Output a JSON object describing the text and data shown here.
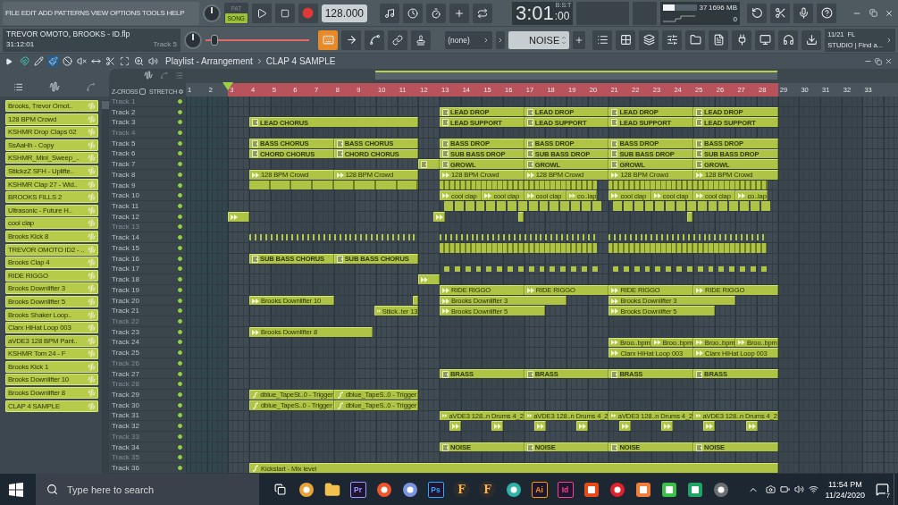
{
  "menu": [
    "FILE",
    "EDIT",
    "ADD",
    "PATTERNS",
    "VIEW",
    "OPTIONS",
    "TOOLS",
    "HELP"
  ],
  "mode": [
    {
      "label": "PAT",
      "selected": false
    },
    {
      "label": "SONG",
      "selected": true
    }
  ],
  "tempo": "128.000",
  "time": {
    "main": "3:01",
    "sub": ":00",
    "format": "B:S:T"
  },
  "cpu": {
    "level": 0.35,
    "value": "37",
    "memory": "1696 MB",
    "polyphony": "0"
  },
  "hint": {
    "title": "TREVOR OMOTO, BROOKS - ID.flp",
    "time": "31:12:01",
    "track": "Track 5"
  },
  "pitch": {
    "level": 0.05
  },
  "typing_keyboard": {
    "on": true
  },
  "pattern_select": "(none)",
  "pattern_name": "NOISE",
  "news": {
    "date": "11/21",
    "title": "FL",
    "text": "STUDIO | Find a..."
  },
  "playlist": {
    "title": "Playlist - Arrangement",
    "selected": "CLAP 4 SAMPLE",
    "tools": [
      {
        "kind": "pencil",
        "selected": false
      },
      {
        "kind": "brush",
        "selected": true
      },
      {
        "kind": "delete",
        "selected": false
      },
      {
        "kind": "mute",
        "selected": false
      },
      {
        "kind": "slip",
        "selected": false
      },
      {
        "kind": "slice",
        "selected": false
      },
      {
        "kind": "select",
        "selected": false
      },
      {
        "kind": "zoom",
        "selected": false
      },
      {
        "kind": "playback",
        "selected": false
      }
    ],
    "zcross": {
      "label": "Z-CROSS",
      "checked": false
    },
    "stretch": {
      "label": "STRETCH",
      "on": false
    }
  },
  "picker": [
    {
      "label": "Brooks, Trevor Omot.."
    },
    {
      "label": "128 BPM Crowd"
    },
    {
      "label": "KSHMR Drop Claps 02"
    },
    {
      "label": "SsAaHh - Copy"
    },
    {
      "label": "KSHMR_Mini_Sweep_.."
    },
    {
      "label": "StiickzZ SFH - Uplifte.."
    },
    {
      "label": "KSHMR Clap 27 - Wid.."
    },
    {
      "label": "BROOKS FILLS 2"
    },
    {
      "label": "Ultrasonic - Future H.."
    },
    {
      "label": "cool clap"
    },
    {
      "label": "Brooks Kick 8"
    },
    {
      "label": "TREVOR OMOTO ID2 - .."
    },
    {
      "label": "Brooks Clap 4"
    },
    {
      "label": "RIDE RIGGO"
    },
    {
      "label": "Brooks Downlifter 3"
    },
    {
      "label": "Brooks Downlifter 5"
    },
    {
      "label": "Brooks Shaker Loop.."
    },
    {
      "label": "Clarx HiHat Loop 003"
    },
    {
      "label": "aVDE3 128 BPM Pant.."
    },
    {
      "label": "KSHMR Tom 24 - F"
    },
    {
      "label": "Brooks Kick 1"
    },
    {
      "label": "Brooks Downlifter 10"
    },
    {
      "label": "Brooks Downlifter 8"
    },
    {
      "label": "CLAP 4 SAMPLE"
    }
  ],
  "ruler": {
    "bars": [
      "1",
      "2",
      "3",
      "4",
      "5",
      "6",
      "7",
      "8",
      "9",
      "10",
      "11",
      "12",
      "13",
      "14",
      "15",
      "16",
      "17",
      "18",
      "19",
      "20",
      "21",
      "22",
      "23",
      "24",
      "25",
      "26",
      "27",
      "28",
      "29",
      "30",
      "31",
      "32",
      "33"
    ]
  },
  "tracks": [
    {
      "name": "Track 1",
      "dimmed": true,
      "on": true
    },
    {
      "name": "Track 2",
      "dimmed": false,
      "on": true,
      "clips": [
        {
          "kind": "pattern",
          "label": "LEAD DROP"
        },
        {
          "kind": "pattern",
          "label": "LEAD DROP"
        },
        {
          "kind": "pattern",
          "label": "LEAD DROP"
        },
        {
          "kind": "pattern",
          "label": "LEAD DROP"
        }
      ]
    },
    {
      "name": "Track 3",
      "dimmed": false,
      "on": true,
      "clips": [
        {
          "kind": "pattern",
          "label": "LEAD CHORUS"
        },
        {
          "kind": "pattern",
          "label": "LEAD SUPPORT"
        },
        {
          "kind": "pattern",
          "label": "LEAD SUPPORT"
        },
        {
          "kind": "pattern",
          "label": "LEAD SUPPORT"
        },
        {
          "kind": "pattern",
          "label": "LEAD SUPPORT"
        }
      ]
    },
    {
      "name": "Track 4",
      "dimmed": true,
      "on": true
    },
    {
      "name": "Track 5",
      "dimmed": false,
      "on": true,
      "clips": [
        {
          "kind": "pattern",
          "label": "BASS CHORUS"
        },
        {
          "kind": "pattern",
          "label": "BASS CHORUS"
        },
        {
          "kind": "pattern",
          "label": "BASS DROP"
        },
        {
          "kind": "pattern",
          "label": "BASS DROP"
        },
        {
          "kind": "pattern",
          "label": "BASS DROP"
        },
        {
          "kind": "pattern",
          "label": "BASS DROP"
        }
      ]
    },
    {
      "name": "Track 6",
      "dimmed": false,
      "on": true,
      "clips": [
        {
          "kind": "pattern",
          "label": "CHORD CHORUS"
        },
        {
          "kind": "pattern",
          "label": "CHORD CHORUS"
        },
        {
          "kind": "pattern",
          "label": "SUB BASS DROP"
        },
        {
          "kind": "pattern",
          "label": "SUB BASS DROP"
        },
        {
          "kind": "pattern",
          "label": "SUB BASS DROP"
        },
        {
          "kind": "pattern",
          "label": "SUB BASS DROP"
        }
      ]
    },
    {
      "name": "Track 7",
      "dimmed": false,
      "on": true,
      "clips": [
        {
          "kind": "pattern"
        },
        {
          "kind": "pattern",
          "label": "GROWL"
        },
        {
          "kind": "pattern",
          "label": "GROWL"
        },
        {
          "kind": "pattern",
          "label": "GROWL"
        },
        {
          "kind": "pattern",
          "label": "GROWL"
        }
      ]
    },
    {
      "name": "Track 8",
      "dimmed": false,
      "on": true,
      "clips": [
        {
          "kind": "audio",
          "label": "128 BPM Crowd"
        },
        {
          "kind": "audio",
          "label": "128 BPM Crowd"
        },
        {
          "kind": "audio",
          "label": "128 BPM Crowd"
        },
        {
          "kind": "audio",
          "label": "128 BPM Crowd"
        },
        {
          "kind": "audio",
          "label": "128 BPM Crowd"
        },
        {
          "kind": "audio",
          "label": "128 BPM Crowd"
        }
      ]
    },
    {
      "name": "Track 9",
      "dimmed": false,
      "on": true,
      "clips": [
        {
          "kind": "blocks"
        },
        {
          "kind": "strips"
        },
        {
          "kind": "strips"
        }
      ]
    },
    {
      "name": "Track 10",
      "dimmed": false,
      "on": true,
      "clips": [
        {
          "kind": "audio",
          "label": "cool clap"
        },
        {
          "kind": "audio",
          "label": "cool clap"
        },
        {
          "kind": "audio",
          "label": "cool clap"
        },
        {
          "kind": "audio",
          "label": "co..lap"
        },
        {
          "kind": "audio",
          "label": "cool clap"
        },
        {
          "kind": "audio",
          "label": "cool clap"
        },
        {
          "kind": "audio",
          "label": "cool clap"
        },
        {
          "kind": "audio",
          "label": "co..lap"
        }
      ]
    },
    {
      "name": "Track 11",
      "dimmed": false,
      "on": true,
      "clips": [
        {
          "kind": "chips"
        },
        {
          "kind": "chips"
        }
      ]
    },
    {
      "name": "Track 12",
      "dimmed": false,
      "on": true,
      "clips": [
        {
          "kind": "audio"
        },
        {
          "kind": "audio"
        },
        {
          "kind": "audio"
        },
        {
          "kind": "audio"
        }
      ]
    },
    {
      "name": "Track 13",
      "dimmed": true,
      "on": true
    },
    {
      "name": "Track 14",
      "dimmed": false,
      "on": true,
      "clips": [
        {
          "kind": "ticks"
        },
        {
          "kind": "ticks"
        },
        {
          "kind": "ticks"
        }
      ]
    },
    {
      "name": "Track 15",
      "dimmed": false,
      "on": true,
      "clips": [
        {
          "kind": "strips"
        },
        {
          "kind": "strips"
        }
      ]
    },
    {
      "name": "Track 16",
      "dimmed": false,
      "on": true,
      "clips": [
        {
          "kind": "pattern",
          "label": "SUB BASS CHORUS"
        },
        {
          "kind": "pattern",
          "label": "SUB BASS CHORUS"
        }
      ]
    },
    {
      "name": "Track 17",
      "dimmed": false,
      "on": true,
      "clips": [
        {
          "kind": "pegs"
        },
        {
          "kind": "pegs"
        }
      ]
    },
    {
      "name": "Track 18",
      "dimmed": false,
      "on": true,
      "clips": [
        {
          "kind": "audio"
        }
      ]
    },
    {
      "name": "Track 19",
      "dimmed": false,
      "on": true,
      "clips": [
        {
          "kind": "audio",
          "label": "RIDE RIGGO"
        },
        {
          "kind": "audio",
          "label": "RIDE RIGGO"
        },
        {
          "kind": "audio",
          "label": "RIDE RIGGO"
        },
        {
          "kind": "audio",
          "label": "RIDE RIGGO"
        }
      ]
    },
    {
      "name": "Track 20",
      "dimmed": false,
      "on": true,
      "clips": [
        {
          "kind": "audio",
          "label": "Brooks Downlifter 10"
        },
        {
          "kind": "audio"
        },
        {
          "kind": "audio",
          "label": "Brooks Downlifter 3"
        },
        {
          "kind": "audio",
          "label": "Brooks Downlifter 3"
        }
      ]
    },
    {
      "name": "Track 21",
      "dimmed": false,
      "on": true,
      "clips": [
        {
          "kind": "audio",
          "label": "Stiick..ter 13"
        },
        {
          "kind": "audio",
          "label": "Brooks Downlifter 5"
        },
        {
          "kind": "audio",
          "label": "Brooks Downlifter 5"
        }
      ]
    },
    {
      "name": "Track 22",
      "dimmed": true,
      "on": true
    },
    {
      "name": "Track 23",
      "dimmed": false,
      "on": true,
      "clips": [
        {
          "kind": "audio",
          "label": "Brooks Downlifter 8"
        }
      ]
    },
    {
      "name": "Track 24",
      "dimmed": false,
      "on": true,
      "clips": [
        {
          "kind": "audio",
          "label": "Broo..bpm"
        },
        {
          "kind": "audio",
          "label": "Broo..bpm"
        },
        {
          "kind": "audio",
          "label": "Broo..bpm"
        },
        {
          "kind": "audio",
          "label": "Broo..bpm"
        }
      ]
    },
    {
      "name": "Track 25",
      "dimmed": false,
      "on": true,
      "clips": [
        {
          "kind": "audio",
          "label": "Clarx HiHat Loop 003"
        },
        {
          "kind": "audio",
          "label": "Clarx HiHat Loop 003"
        }
      ]
    },
    {
      "name": "Track 26",
      "dimmed": true,
      "on": true
    },
    {
      "name": "Track 27",
      "dimmed": false,
      "on": true,
      "clips": [
        {
          "kind": "pattern",
          "label": "BRASS"
        },
        {
          "kind": "pattern",
          "label": "BRASS"
        },
        {
          "kind": "pattern",
          "label": "BRASS"
        },
        {
          "kind": "pattern",
          "label": "BRASS"
        }
      ]
    },
    {
      "name": "Track 28",
      "dimmed": true,
      "on": true
    },
    {
      "name": "Track 29",
      "dimmed": false,
      "on": true,
      "clips": [
        {
          "kind": "automation",
          "label": "dblue_TapeSt..0 - Trigger"
        },
        {
          "kind": "automation",
          "label": "dblue_TapeS..0 - Trigger"
        }
      ]
    },
    {
      "name": "Track 30",
      "dimmed": false,
      "on": true,
      "clips": [
        {
          "kind": "automation",
          "label": "dblue_TapeS..0 - Trigger"
        },
        {
          "kind": "automation",
          "label": "dblue_TapeS..0 - Trigger"
        }
      ]
    },
    {
      "name": "Track 31",
      "dimmed": false,
      "on": true,
      "clips": [
        {
          "kind": "audio",
          "label": "aVDE3 128..n Drums 4_2"
        },
        {
          "kind": "audio",
          "label": "aVDE3 128..n Drums 4_2"
        },
        {
          "kind": "audio",
          "label": "aVDE3 128..n Drums 4_2"
        },
        {
          "kind": "audio",
          "label": "aVDE3 128..n Drums 4_2"
        }
      ]
    },
    {
      "name": "Track 32",
      "dimmed": false,
      "on": true,
      "clips": [
        {
          "kind": "audio"
        },
        {
          "kind": "audio"
        },
        {
          "kind": "audio"
        },
        {
          "kind": "audio"
        },
        {
          "kind": "audio"
        },
        {
          "kind": "audio"
        },
        {
          "kind": "audio"
        },
        {
          "kind": "audio"
        }
      ]
    },
    {
      "name": "Track 33",
      "dimmed": true,
      "on": true
    },
    {
      "name": "Track 34",
      "dimmed": false,
      "on": true,
      "clips": [
        {
          "kind": "pattern",
          "label": "NOISE"
        },
        {
          "kind": "pattern",
          "label": "NOISE"
        },
        {
          "kind": "pattern",
          "label": "NOISE"
        },
        {
          "kind": "pattern",
          "label": "NOISE"
        }
      ]
    },
    {
      "name": "Track 35",
      "dimmed": true,
      "on": true
    },
    {
      "name": "Track 36",
      "dimmed": false,
      "on": true,
      "clips": [
        {
          "kind": "automation",
          "label": "Kickstart - Mix level"
        }
      ]
    }
  ],
  "taskbar": {
    "search": {
      "placeholder": "Type here to search"
    },
    "apps": [
      {
        "kind": "disc",
        "color": "#e8a33c"
      },
      {
        "kind": "folder"
      },
      {
        "kind": "badge",
        "glyph": "Pr",
        "color": "#9999ff"
      },
      {
        "kind": "disc",
        "color": "#f0542d"
      },
      {
        "kind": "disc",
        "color": "#7b93e0"
      },
      {
        "kind": "badge",
        "glyph": "Ps",
        "color": "#31a8ff"
      },
      {
        "kind": "letter",
        "glyph": "F"
      },
      {
        "kind": "letter",
        "glyph": "F"
      },
      {
        "kind": "disc",
        "color": "#2fb3a6"
      },
      {
        "kind": "badge",
        "glyph": "Ai",
        "color": "#ff9a00"
      },
      {
        "kind": "badge",
        "glyph": "Id",
        "color": "#ff3d8b"
      },
      {
        "kind": "tile",
        "color": "#e64a19"
      },
      {
        "kind": "disc",
        "color": "#e0202a"
      },
      {
        "kind": "tile",
        "color": "#f07d3a"
      },
      {
        "kind": "tile",
        "color": "#3cc04a"
      },
      {
        "kind": "tile",
        "color": "#21a366"
      },
      {
        "kind": "disc",
        "color": "#6b6f73"
      }
    ],
    "clock": "11:54 PM",
    "date": "11/24/2020",
    "notifications": "7"
  }
}
